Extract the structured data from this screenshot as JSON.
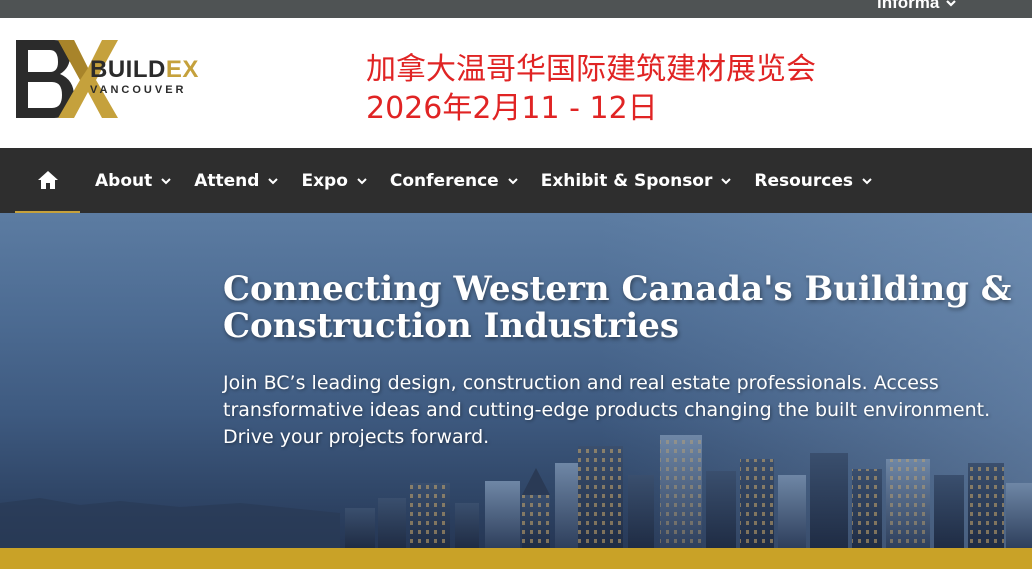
{
  "topbar": {
    "brand": "informa"
  },
  "header": {
    "logo_build": "BUILD",
    "logo_ex": "EX",
    "logo_city": "VANCOUVER",
    "headline_line1": "加拿大温哥华国际建筑建材展览会",
    "headline_line2": "2026年2月11 - 12日"
  },
  "nav": {
    "home_icon": "home-icon",
    "items": [
      {
        "label": "About"
      },
      {
        "label": "Attend"
      },
      {
        "label": "Expo"
      },
      {
        "label": "Conference"
      },
      {
        "label": "Exhibit & Sponsor"
      },
      {
        "label": "Resources"
      }
    ]
  },
  "hero": {
    "title": "Connecting Western Canada's Building & Construction Industries",
    "text": "Join BC’s leading design, construction and real estate professionals. Access transformative ideas and cutting-edge products changing the built environment. Drive your projects forward."
  },
  "colors": {
    "accent_gold": "#c5a13c",
    "headline_red": "#e02424",
    "nav_bg": "#2e2e2e",
    "topbar_bg": "#4f5354"
  }
}
